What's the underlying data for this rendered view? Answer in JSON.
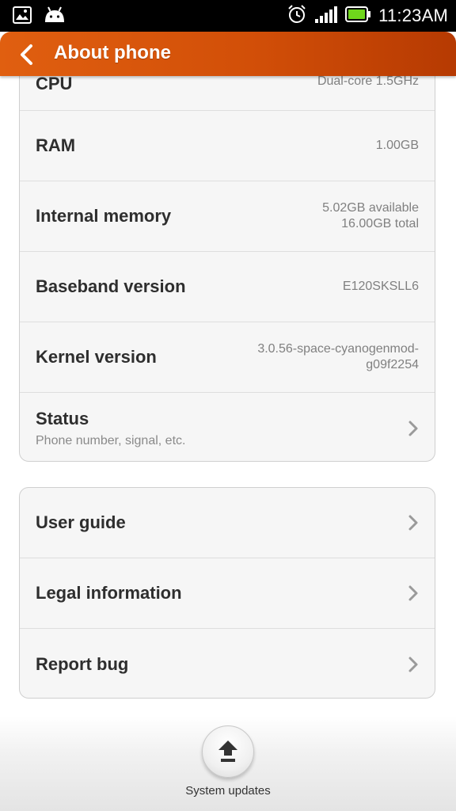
{
  "status_bar": {
    "time": "11:23AM",
    "icons": [
      "gallery-icon",
      "android-icon",
      "alarm-icon",
      "signal-icon",
      "battery-icon"
    ]
  },
  "action_bar": {
    "title": "About phone"
  },
  "info_rows": [
    {
      "label": "CPU",
      "value": "Dual-core 1.5GHz"
    },
    {
      "label": "RAM",
      "value": "1.00GB"
    },
    {
      "label": "Internal memory",
      "value_line1": "5.02GB available",
      "value_line2": "16.00GB total"
    },
    {
      "label": "Baseband version",
      "value": "E120SKSLL6"
    },
    {
      "label": "Kernel version",
      "value_line1": "3.0.56-space-cyanogenmod-",
      "value_line2": "g09f2254"
    }
  ],
  "status_row": {
    "label": "Status",
    "subtitle": "Phone number, signal, etc."
  },
  "links": [
    {
      "label": "User guide"
    },
    {
      "label": "Legal information"
    },
    {
      "label": "Report bug"
    }
  ],
  "system_updates": {
    "label": "System updates"
  },
  "colors": {
    "accent": "#d24f08",
    "battery": "#6fd61c"
  }
}
